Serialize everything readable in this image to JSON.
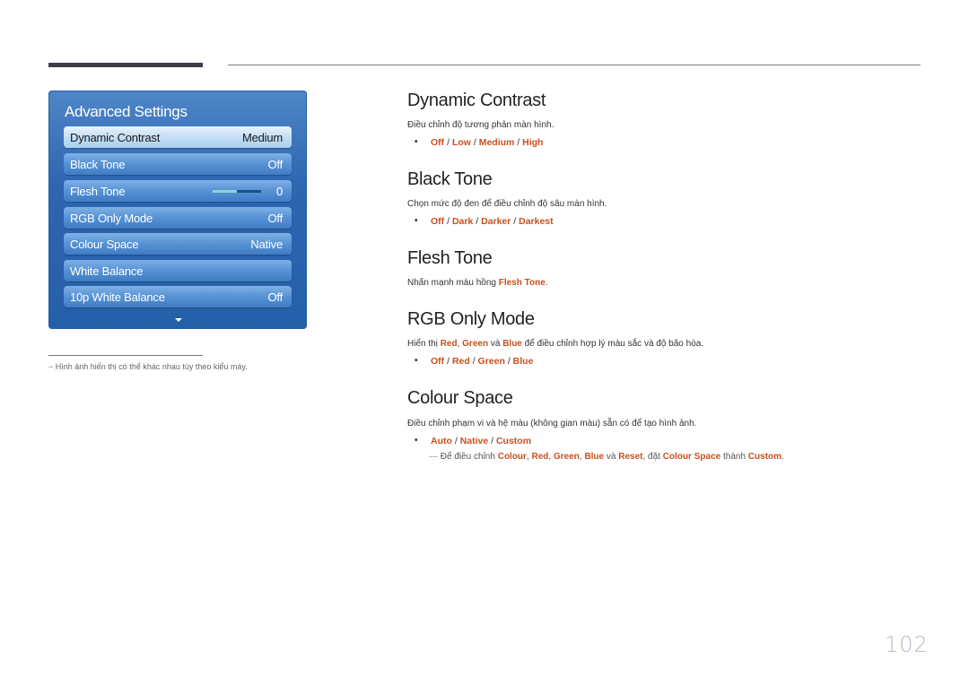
{
  "panel": {
    "title": "Advanced Settings",
    "items": [
      {
        "label": "Dynamic Contrast",
        "value": "Medium"
      },
      {
        "label": "Black Tone",
        "value": "Off"
      },
      {
        "label": "Flesh Tone",
        "value": "0"
      },
      {
        "label": "RGB Only Mode",
        "value": "Off"
      },
      {
        "label": "Colour Space",
        "value": "Native"
      },
      {
        "label": "White Balance",
        "value": ""
      },
      {
        "label": "10p White Balance",
        "value": "Off"
      }
    ],
    "flesh_tone_slider_fraction": 0.5
  },
  "footnote": "−  Hình ảnh hiển thị có thể khác nhau tùy theo kiểu máy.",
  "sections": {
    "dynamic_contrast": {
      "title": "Dynamic Contrast",
      "desc": "Điều chỉnh độ tương phản màn hình.",
      "options": [
        "Off",
        "Low",
        "Medium",
        "High"
      ]
    },
    "black_tone": {
      "title": "Black Tone",
      "desc": "Chọn mức độ đen để điều chỉnh độ sâu màn hình.",
      "options": [
        "Off",
        "Dark",
        "Darker",
        "Darkest"
      ]
    },
    "flesh_tone": {
      "title": "Flesh Tone",
      "desc_prefix": "Nhấn mạnh màu hồng ",
      "desc_hl": "Flesh Tone",
      "desc_suffix": "."
    },
    "rgb_only": {
      "title": "RGB Only Mode",
      "desc_1": "Hiển thị ",
      "hl_red": "Red",
      "sep_1": ", ",
      "hl_green": "Green",
      "desc_2": " và ",
      "hl_blue": "Blue",
      "desc_3": " để điều chỉnh hợp lý màu sắc và độ bão hòa.",
      "options": [
        "Off",
        "Red",
        "Green",
        "Blue"
      ]
    },
    "colour_space": {
      "title": "Colour Space",
      "desc": "Điều chỉnh phạm vi và hệ màu (không gian màu) sẵn có để tạo hình ảnh.",
      "options": [
        "Auto",
        "Native",
        "Custom"
      ],
      "note": {
        "dash": "―",
        "t1": " Để điều chỉnh ",
        "h1": "Colour",
        "t2": ", ",
        "h2": "Red",
        "t3": ", ",
        "h3": "Green",
        "t4": ", ",
        "h4": "Blue",
        "t5": " và ",
        "h5": "Reset",
        "t6": ", đặt ",
        "h6": "Colour Space",
        "t7": " thành ",
        "h7": "Custom",
        "t8": "."
      }
    }
  },
  "bullet": "•",
  "slash": " / ",
  "page_number": "102"
}
